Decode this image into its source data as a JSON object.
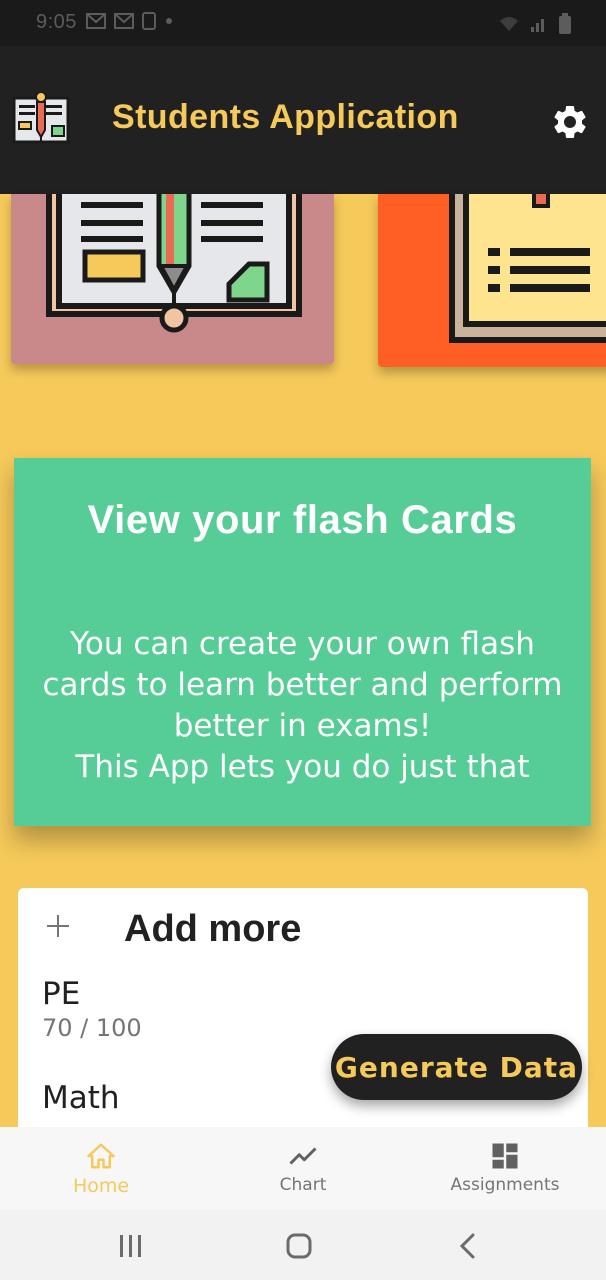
{
  "status_bar": {
    "time": "9:05"
  },
  "app_bar": {
    "title": "Students Application",
    "logo_icon": "notebook-pencil-icon",
    "settings_icon": "gear-icon"
  },
  "tiles": [
    {
      "name": "notebook-tile",
      "icon": "notebook-pencil-icon",
      "color": "#C9888A"
    },
    {
      "name": "clipboard-tile",
      "icon": "clipboard-icon",
      "color": "#FF5F24"
    }
  ],
  "flash_card": {
    "title": "View your flash Cards",
    "description": "You can create your own flash\ncards to learn better and perform\nbetter in exams!\nThis App lets you do just that",
    "color": "#56CC97"
  },
  "subjects": {
    "add_more_label": "Add more",
    "add_icon": "plus-icon",
    "items": [
      {
        "name": "PE",
        "score": "70 / 100"
      },
      {
        "name": "Math"
      }
    ]
  },
  "fab": {
    "label": "Generate Data"
  },
  "bottom_nav": {
    "items": [
      {
        "label": "Home",
        "icon": "home-icon",
        "active": true
      },
      {
        "label": "Chart",
        "icon": "line-chart-icon",
        "active": false
      },
      {
        "label": "Assignments",
        "icon": "dashboard-icon",
        "active": false
      }
    ]
  },
  "colors": {
    "accent": "#F5C95A",
    "background": "#F5C95A",
    "app_bar": "#212121",
    "fab": "#212121"
  }
}
